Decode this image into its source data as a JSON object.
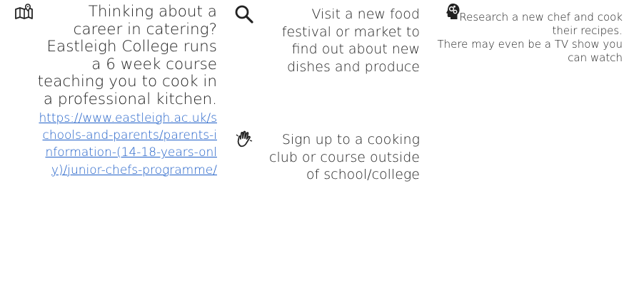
{
  "columns": {
    "career": {
      "icon": "map-icon",
      "text": "Thinking about a career in catering? Eastleigh College runs a 6 week course teaching you to cook in a professional kitchen.",
      "link": "https://www.eastleigh.ac.uk/schools-and-parents/parents-information-(14-18-years-only)/junior-chefs-programme/"
    },
    "festival": {
      "icon": "search-icon",
      "text": "Visit a new food festival or market to find out about new dishes and produce"
    },
    "club": {
      "icon": "hand-sign-icon",
      "text": "Sign up to a cooking club or course outside of school/college"
    },
    "chef": {
      "icon": "head-gears-icon",
      "text_line1": "Research a new chef and cook their recipes.",
      "text_line2": "There may even be a TV show you can watch"
    }
  },
  "colors": {
    "link": "#1f5fc8",
    "text": "#222222"
  }
}
